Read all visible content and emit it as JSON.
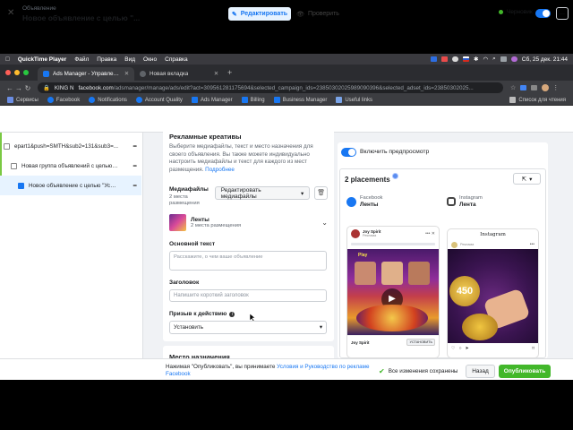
{
  "menubar": {
    "app": "QuickTime Player",
    "items": [
      "Файл",
      "Правка",
      "Вид",
      "Окно",
      "Справка"
    ],
    "clock": "Сб, 25 дек.  21:44"
  },
  "tabs": [
    {
      "label": "Ads Manager - Управление р",
      "active": true
    },
    {
      "label": "Новая вкладка",
      "active": false
    }
  ],
  "address": {
    "profile": "KING N",
    "host": "facebook.com",
    "path": "/adsmanager/manage/ads/edit?act=309561281175694&selected_campaign_ids=23850302025989090396&selected_adset_ids=23850302025..."
  },
  "bookmarks": {
    "items": [
      "Сервисы",
      "Facebook",
      "Notifications",
      "Account Quality",
      "Ads Manager",
      "Billing",
      "Business Manager",
      "Useful links"
    ],
    "reading_list": "Список для чтения"
  },
  "header": {
    "subtitle": "Объявление",
    "title": "Новое объявление с целью \"...",
    "edit_label": "Редактировать",
    "preview_label": "Проверить",
    "status": "Черновик",
    "more": "..."
  },
  "tree": {
    "campaign": "epart1&push=SMTH&sub2=131&sub3=...",
    "adset": "Новая группа объявлений с целью \"...",
    "ad": "Новое объявление с целью \"Уста..."
  },
  "form": {
    "section_title": "Рекламные креативы",
    "section_desc": "Выберите медиафайлы, текст и место назначения для своего объявления. Вы также можете индивидуально настроить медиафайлы и текст для каждого из мест размещения.",
    "learn_more": "Подробнее",
    "media_label": "Медиафайлы",
    "media_count": "2 места размещения",
    "edit_media_label": "Редактировать медиафайлы",
    "feed_label": "Ленты",
    "feed_sub": "2 места размещения",
    "primary_text_label": "Основной текст",
    "primary_text_placeholder": "Расскажите, о чем ваше объявление",
    "headline_label": "Заголовок",
    "headline_placeholder": "Напишите короткий заголовок",
    "cta_label": "Призыв к действию",
    "cta_value": "Установить",
    "destination_title": "Место назначения"
  },
  "preview": {
    "toggle_label": "Включить предпросмотр",
    "placements": "2 placements",
    "facebook": {
      "platform": "Facebook",
      "name": "Ленты",
      "page": "Joy Spirit",
      "sponsored": "Реклама",
      "cta": "УСТАНОВИТЬ",
      "banner": "Play"
    },
    "instagram": {
      "platform": "Instagram",
      "name": "Лента",
      "brand": "Instagram",
      "account": "Реклама",
      "number": "450"
    }
  },
  "footer": {
    "text_before": "Нажимая \"Опубликовать\", вы принимаете ",
    "terms": "Условия и Руководство по рекламе Facebook",
    "saved": "Все изменения сохранены",
    "back": "Назад",
    "publish": "Опубликовать"
  },
  "colors": {
    "brand": "#1877f2",
    "publish": "#42b72a"
  }
}
